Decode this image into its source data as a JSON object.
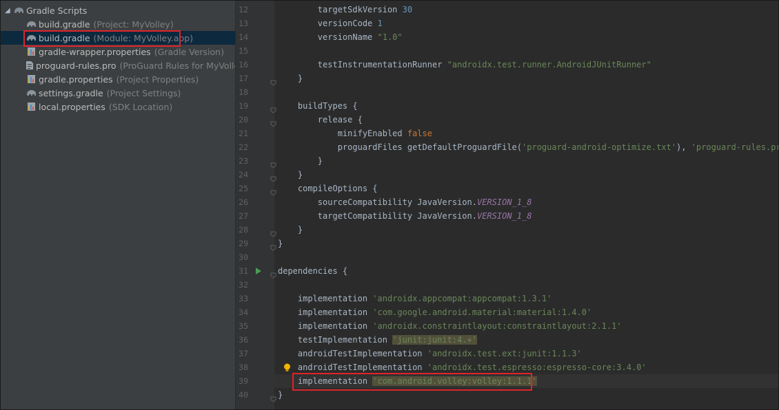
{
  "project_tree": {
    "root": {
      "label": "Gradle Scripts"
    },
    "items": [
      {
        "label": "build.gradle",
        "hint": "(Project: MyVolley)",
        "icon": "gradle-icon"
      },
      {
        "label": "build.gradle",
        "hint": "(Module: MyVolley.app)",
        "icon": "gradle-icon"
      },
      {
        "label": "gradle-wrapper.properties",
        "hint": "(Gradle Version)",
        "icon": "properties-icon"
      },
      {
        "label": "proguard-rules.pro",
        "hint": "(ProGuard Rules for MyVolley.app)",
        "icon": "text-file-icon"
      },
      {
        "label": "gradle.properties",
        "hint": "(Project Properties)",
        "icon": "properties-icon"
      },
      {
        "label": "settings.gradle",
        "hint": "(Project Settings)",
        "icon": "gradle-icon"
      },
      {
        "label": "local.properties",
        "hint": "(SDK Location)",
        "icon": "properties-icon"
      }
    ],
    "selected_index": 1
  },
  "editor": {
    "current_line": "39",
    "lines": [
      {
        "n": "12",
        "t": [
          [
            "        targetSdkVersion ",
            ""
          ],
          [
            "30",
            "num"
          ]
        ]
      },
      {
        "n": "13",
        "t": [
          [
            "        versionCode ",
            ""
          ],
          [
            "1",
            "num"
          ]
        ]
      },
      {
        "n": "14",
        "t": [
          [
            "        versionName ",
            ""
          ],
          [
            "\"1.0\"",
            "str"
          ]
        ]
      },
      {
        "n": "15",
        "t": []
      },
      {
        "n": "16",
        "t": [
          [
            "        testInstrumentationRunner ",
            ""
          ],
          [
            "\"androidx.test.runner.AndroidJUnitRunner\"",
            "str"
          ]
        ]
      },
      {
        "n": "17",
        "t": [
          [
            "    }",
            ""
          ]
        ]
      },
      {
        "n": "18",
        "t": []
      },
      {
        "n": "19",
        "t": [
          [
            "    buildTypes {",
            ""
          ]
        ]
      },
      {
        "n": "20",
        "t": [
          [
            "        release {",
            ""
          ]
        ]
      },
      {
        "n": "21",
        "t": [
          [
            "            minifyEnabled ",
            ""
          ],
          [
            "false",
            "kw"
          ]
        ]
      },
      {
        "n": "22",
        "t": [
          [
            "            proguardFiles getDefaultProguardFile(",
            ""
          ],
          [
            "'proguard-android-optimize.txt'",
            "str"
          ],
          [
            "), ",
            ""
          ],
          [
            "'proguard-rules.pro'",
            "str"
          ]
        ]
      },
      {
        "n": "23",
        "t": [
          [
            "        }",
            ""
          ]
        ]
      },
      {
        "n": "24",
        "t": [
          [
            "    }",
            ""
          ]
        ]
      },
      {
        "n": "25",
        "t": [
          [
            "    compileOptions {",
            ""
          ]
        ]
      },
      {
        "n": "26",
        "t": [
          [
            "        sourceCompatibility JavaVersion.",
            ""
          ],
          [
            "VERSION_1_8",
            "ital"
          ]
        ]
      },
      {
        "n": "27",
        "t": [
          [
            "        targetCompatibility JavaVersion.",
            ""
          ],
          [
            "VERSION_1_8",
            "ital"
          ]
        ]
      },
      {
        "n": "28",
        "t": [
          [
            "    }",
            ""
          ]
        ]
      },
      {
        "n": "29",
        "t": [
          [
            "}",
            ""
          ]
        ]
      },
      {
        "n": "30",
        "t": []
      },
      {
        "n": "31",
        "t": [
          [
            "dependencies {",
            ""
          ]
        ]
      },
      {
        "n": "32",
        "t": []
      },
      {
        "n": "33",
        "t": [
          [
            "    implementation ",
            ""
          ],
          [
            "'androidx.appcompat:appcompat:1.3.1'",
            "str"
          ]
        ]
      },
      {
        "n": "34",
        "t": [
          [
            "    implementation ",
            ""
          ],
          [
            "'com.google.android.material:material:1.4.0'",
            "str"
          ]
        ]
      },
      {
        "n": "35",
        "t": [
          [
            "    implementation ",
            ""
          ],
          [
            "'androidx.constraintlayout:constraintlayout:2.1.1'",
            "str"
          ]
        ]
      },
      {
        "n": "36",
        "t": [
          [
            "    testImplementation ",
            ""
          ],
          [
            "'junit:junit:4.+'",
            "str str-hl"
          ]
        ]
      },
      {
        "n": "37",
        "t": [
          [
            "    androidTestImplementation ",
            ""
          ],
          [
            "'androidx.test.ext:junit:1.1.3'",
            "str"
          ]
        ]
      },
      {
        "n": "38",
        "t": [
          [
            "    androidTestImplementation ",
            ""
          ],
          [
            "'androidx.test.espresso:espresso-core:3.4.0'",
            "str"
          ]
        ]
      },
      {
        "n": "39",
        "t": [
          [
            "    implementation ",
            ""
          ],
          [
            "'com.android.volley:volley:1.1.1'",
            "str str-hl"
          ]
        ]
      },
      {
        "n": "40",
        "t": [
          [
            "}",
            ""
          ]
        ]
      }
    ]
  },
  "colors": {
    "panel_bg": "#3c3f41",
    "editor_bg": "#2b2b2b",
    "highlight_box": "#e0242b",
    "selection": "#0d293e"
  }
}
